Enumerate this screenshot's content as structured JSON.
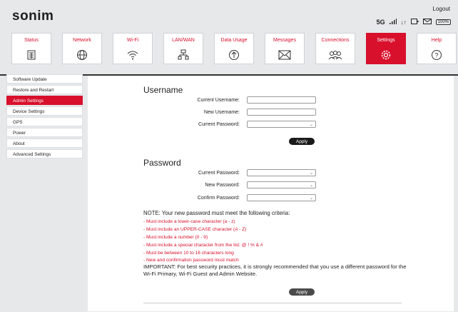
{
  "header": {
    "logo": "sonim",
    "logout": "Logout",
    "status": {
      "network": "5G",
      "battery": "100%"
    }
  },
  "nav": {
    "tabs": [
      {
        "label": "Status",
        "icon": "status-icon",
        "active": false
      },
      {
        "label": "Network",
        "icon": "globe-icon",
        "active": false
      },
      {
        "label": "Wi-Fi",
        "icon": "wifi-icon",
        "active": false
      },
      {
        "label": "LAN/WAN",
        "icon": "lan-icon",
        "active": false
      },
      {
        "label": "Data Usage",
        "icon": "data-usage-icon",
        "active": false
      },
      {
        "label": "Messages",
        "icon": "envelope-icon",
        "active": false
      },
      {
        "label": "Connections",
        "icon": "connections-icon",
        "active": false
      },
      {
        "label": "Settings",
        "icon": "gear-icon",
        "active": true
      },
      {
        "label": "Help",
        "icon": "help-icon",
        "active": false
      }
    ]
  },
  "sidebar": {
    "items": [
      {
        "label": "Software Update",
        "active": false
      },
      {
        "label": "Restore and Restart",
        "active": false
      },
      {
        "label": "Admin Settings",
        "active": true
      },
      {
        "label": "Device Settings",
        "active": false
      },
      {
        "label": "GPS",
        "active": false
      },
      {
        "label": "Power",
        "active": false
      },
      {
        "label": "About",
        "active": false
      },
      {
        "label": "Advanced Settings",
        "active": false
      }
    ]
  },
  "username_section": {
    "title": "Username",
    "fields": [
      {
        "label": "Current Username:",
        "value": ""
      },
      {
        "label": "New Username:",
        "value": ""
      },
      {
        "label": "Current Password:",
        "value": ""
      }
    ],
    "apply": "Apply"
  },
  "password_section": {
    "title": "Password",
    "fields": [
      {
        "label": "Current Password:",
        "value": ""
      },
      {
        "label": "New Password:",
        "value": ""
      },
      {
        "label": "Confirm Password:",
        "value": ""
      }
    ],
    "note": "NOTE: Your new password must meet the following criteria:",
    "criteria": [
      "- Must include a lower-case character (a - z)",
      "- Must include an UPPER-CASE character (A - Z)",
      "- Must include a number (0 - 9)",
      "- Must include a special character from the list: @ ! % & #",
      "- Must be between 10 to 16 characters long",
      "- New and confirmation password must match"
    ],
    "important": "IMPORTANT: For best security practices, it is strongly recommended that you use a different password for the Wi-Fi Primary, Wi-Fi Guest and Admin Website.",
    "apply": "Apply"
  },
  "colors": {
    "accent": "#d8102c"
  }
}
